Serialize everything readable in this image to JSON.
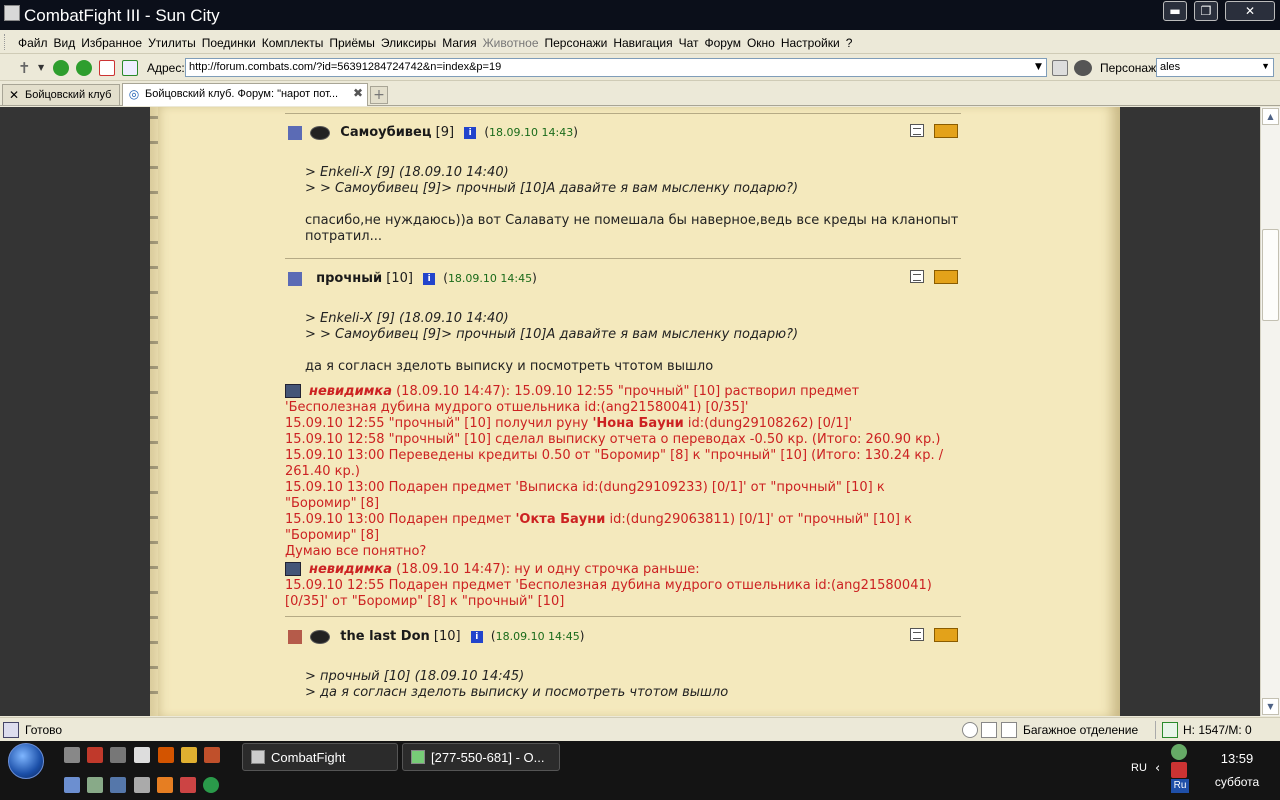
{
  "window": {
    "title": "CombatFight III - Sun City",
    "minimize_glyph": "▬",
    "maximize_glyph": "❐",
    "close_glyph": "✕"
  },
  "menu": {
    "items": [
      "Файл",
      "Вид",
      "Избранное",
      "Утилиты",
      "Поединки",
      "Комплекты",
      "Приёмы",
      "Эликсиры",
      "Магия",
      "Животное",
      "Персонажи",
      "Навигация",
      "Чат",
      "Форум",
      "Окно",
      "Настройки",
      "?"
    ]
  },
  "addressbar": {
    "label": "Адрес:",
    "url": "http://forum.combats.com/?id=5639128472474​2&n=index&p=19",
    "persona_label": "Персонаж:",
    "persona_value": "ales"
  },
  "tabs": [
    {
      "label": "Бойцовский клуб",
      "active": false
    },
    {
      "label": "Бойцовский клуб. Форум: \"нарот пот...",
      "active": true
    }
  ],
  "posts": [
    {
      "nick": "Самоубивец",
      "level": "[9]",
      "date": "18.09.10 14:43",
      "quote1": ">   Enkeli-X [9] (18.09.10 14:40)",
      "quote2": "> > Самоубивец [9]> прочный [10]А давайте я вам мысленку подарю?)",
      "text": "спасибо,не нуждаюсь))а вот Салавату не помешала бы наверное,ведь все креды на кланопыт потратил..."
    },
    {
      "nick": "прочный",
      "level": "[10]",
      "date": "18.09.10 14:45",
      "quote1": ">   Enkeli-X [9] (18.09.10 14:40)",
      "quote2": "> > Самоубивец [9]> прочный [10]А давайте я вам мысленку подарю?)",
      "text": "да я согласн зделоть выписку и посмотреть чтотом вышло"
    },
    {
      "nick": "the last Don",
      "level": "[10]",
      "date": "18.09.10 14:45",
      "quote1": ">   прочный [10] (18.09.10 14:45)",
      "quote2": "> да я согласн зделоть выписку и посмотреть чтотом вышло"
    }
  ],
  "moderation": {
    "inv_name": "невидимка",
    "line1_rest": "  (18.09.10 14:47): 15.09.10 12:55 \"прочный\" [10] растворил предмет",
    "line2": "'Бесполезная дубина мудрого отшельника id:(ang21580041) [0/35]'",
    "line3_pre": "15.09.10 12:55 \"прочный\" [10] получил руну ",
    "line3_bold": "'Нона Бауни",
    "line3_post": " id:(dung29108262) [0/1]'",
    "line4": "15.09.10 12:58 \"прочный\" [10] сделал выписку отчета о переводах -0.50 кр. (Итого: 260.90 кр.)",
    "line5": "15.09.10 13:00 Переведены кредиты 0.50 от \"Боромир\" [8] к \"прочный\" [10] (Итого: 130.24 кр. /",
    "line6": "261.40 кр.)",
    "line7": "15.09.10 13:00 Подарен предмет 'Выписка id:(dung29109233) [0/1]' от \"прочный\" [10] к",
    "line8": "\"Боромир\" [8]",
    "line9_pre": "15.09.10 13:00 Подарен предмет ",
    "line9_bold": "'Окта Бауни",
    "line9_post": " id:(dung29063811) [0/1]' от \"прочный\" [10] к",
    "line10": "\"Боромир\" [8]",
    "line11": "Думаю все понятно?",
    "line12_rest": "  (18.09.10 14:47): ну и одну строчка раньше:",
    "line13": "15.09.10 12:55 Подарен предмет 'Бесполезная дубина мудрого отшельника id:(ang21580041)",
    "line14": "[0/35]' от \"Боромир\" [8] к \"прочный\" [10]"
  },
  "statusbar": {
    "status": "Готово",
    "bag": "Багажное отделение",
    "hp": "Н: 1547/М: 0"
  },
  "taskbar": {
    "task1": "CombatFight",
    "task2": "[277-550-681] - O...",
    "tray_ru": "RU",
    "lang": "Ru",
    "time": "13:59",
    "day": "суббота"
  },
  "colors": {
    "parchment": "#f4e9bd",
    "moderator_red": "#cc2222",
    "date_green": "#1a6b1a"
  }
}
